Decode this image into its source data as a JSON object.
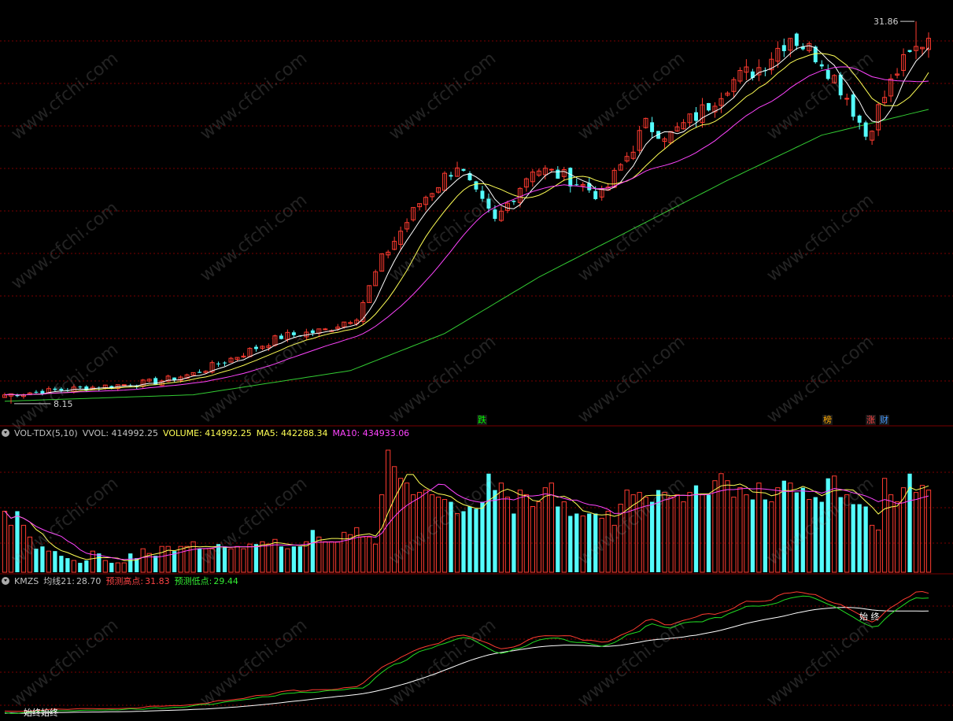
{
  "colors": {
    "up": "#ff3b30",
    "down": "#54fcfc",
    "ma5": "#ffffff",
    "ma10": "#ffff55",
    "ma20": "#ff44ff",
    "ma60": "#33cc33",
    "grid": "#7a0000",
    "divider": "#7a0000"
  },
  "price_panel": {
    "high_label": "31.86",
    "low_label": "8.15"
  },
  "markers": [
    {
      "text": "跌",
      "color": "#00ff00"
    },
    {
      "text": "榜",
      "color": "#ffaa00"
    },
    {
      "text": "涨",
      "color": "#ff4444"
    },
    {
      "text": "财",
      "color": "#4499ff"
    }
  ],
  "volume_header": {
    "name": "VOL-TDX(5,10)",
    "vvol": "VVOL: 414992.25",
    "volume": "VOLUME: 414992.25",
    "ma5": "MA5: 442288.34",
    "ma10": "MA10: 434933.06"
  },
  "kmzs_header": {
    "name": "KMZS",
    "avg_label": "均线21:",
    "avg_value": "28.70",
    "high_label": "预测高点:",
    "high_value": "31.83",
    "low_label": "预测低点:",
    "low_value": "29.44"
  },
  "kmzs_annotations": {
    "start_end_bottom": "始终始终",
    "start_end_top": "始  终"
  },
  "watermark": "www.cfchi.com",
  "chart_data": [
    {
      "type": "candlestick",
      "title": "",
      "series": [
        {
          "name": "K线"
        },
        {
          "name": "MA5"
        },
        {
          "name": "MA10"
        },
        {
          "name": "MA20"
        },
        {
          "name": "MA60"
        }
      ],
      "ylim": [
        7.8,
        32.5
      ],
      "annotations": [
        "31.86",
        "8.15"
      ],
      "anchors": [
        [
          0,
          8.7
        ],
        [
          15,
          9.2
        ],
        [
          24,
          9.5
        ],
        [
          30,
          10.0
        ],
        [
          37,
          11.1
        ],
        [
          44,
          12.3
        ],
        [
          51,
          12.7
        ],
        [
          56,
          13.6
        ],
        [
          60,
          17.1
        ],
        [
          66,
          20.6
        ],
        [
          72,
          23.0
        ],
        [
          75,
          21.0
        ],
        [
          78,
          19.4
        ],
        [
          84,
          22.8
        ],
        [
          90,
          22.1
        ],
        [
          95,
          21.0
        ],
        [
          102,
          25.4
        ],
        [
          106,
          24.8
        ],
        [
          111,
          26.3
        ],
        [
          115,
          28.0
        ],
        [
          120,
          29.0
        ],
        [
          125,
          31.0
        ],
        [
          130,
          29.5
        ],
        [
          134,
          27.2
        ],
        [
          137,
          24.8
        ],
        [
          142,
          28.8
        ],
        [
          147,
          31.0
        ]
      ],
      "ma60_anchors": [
        [
          0,
          8.3
        ],
        [
          30,
          8.7
        ],
        [
          55,
          10.2
        ],
        [
          70,
          12.5
        ],
        [
          85,
          16.0
        ],
        [
          100,
          19.0
        ],
        [
          115,
          22.0
        ],
        [
          130,
          24.8
        ],
        [
          147,
          26.4
        ]
      ],
      "grid_lines": 9
    },
    {
      "type": "bar",
      "title": "VOL-TDX(5,10)",
      "series": [
        {
          "name": "VOLUME"
        },
        {
          "name": "MA5"
        },
        {
          "name": "MA10"
        }
      ],
      "ylim": [
        0,
        560000
      ],
      "values": [
        260000,
        200000,
        260000,
        200000,
        150000,
        100000,
        110000,
        90000,
        90000,
        70000,
        60000,
        50000,
        40000,
        50000,
        90000,
        80000,
        50000,
        40000,
        40000,
        40000,
        80000,
        60000,
        100000,
        80000,
        70000,
        110000,
        110000,
        90000,
        110000,
        110000,
        130000,
        100000,
        100000,
        100000,
        120000,
        110000,
        100000,
        110000,
        100000,
        120000,
        120000,
        130000,
        120000,
        140000,
        110000,
        100000,
        110000,
        110000,
        130000,
        180000,
        150000,
        130000,
        130000,
        130000,
        170000,
        160000,
        190000,
        150000,
        150000,
        120000,
        330000,
        520000,
        450000,
        400000,
        380000,
        330000,
        340000,
        350000,
        330000,
        320000,
        310000,
        300000,
        250000,
        260000,
        280000,
        270000,
        300000,
        420000,
        350000,
        380000,
        320000,
        250000,
        350000,
        330000,
        280000,
        300000,
        360000,
        380000,
        280000,
        300000,
        240000,
        250000,
        240000,
        250000,
        250000,
        230000,
        260000,
        200000,
        290000,
        350000,
        330000,
        340000,
        320000,
        300000,
        350000,
        340000,
        320000,
        330000,
        300000,
        340000,
        370000,
        330000,
        330000,
        390000,
        420000,
        390000,
        320000,
        360000,
        330000,
        310000,
        380000,
        310000,
        300000,
        360000,
        390000,
        380000,
        340000,
        360000,
        310000,
        320000,
        300000,
        400000,
        410000,
        320000,
        330000,
        290000,
        290000,
        280000,
        200000,
        180000,
        400000,
        330000,
        300000,
        360000,
        420000,
        340000,
        370000,
        350000
      ],
      "grid_lines": 3
    },
    {
      "type": "line",
      "title": "KMZS",
      "series": [
        {
          "name": "均线21"
        },
        {
          "name": "预测高点"
        },
        {
          "name": "预测低点"
        }
      ],
      "ylim": [
        7.8,
        32.5
      ],
      "grid_lines": 4
    }
  ]
}
